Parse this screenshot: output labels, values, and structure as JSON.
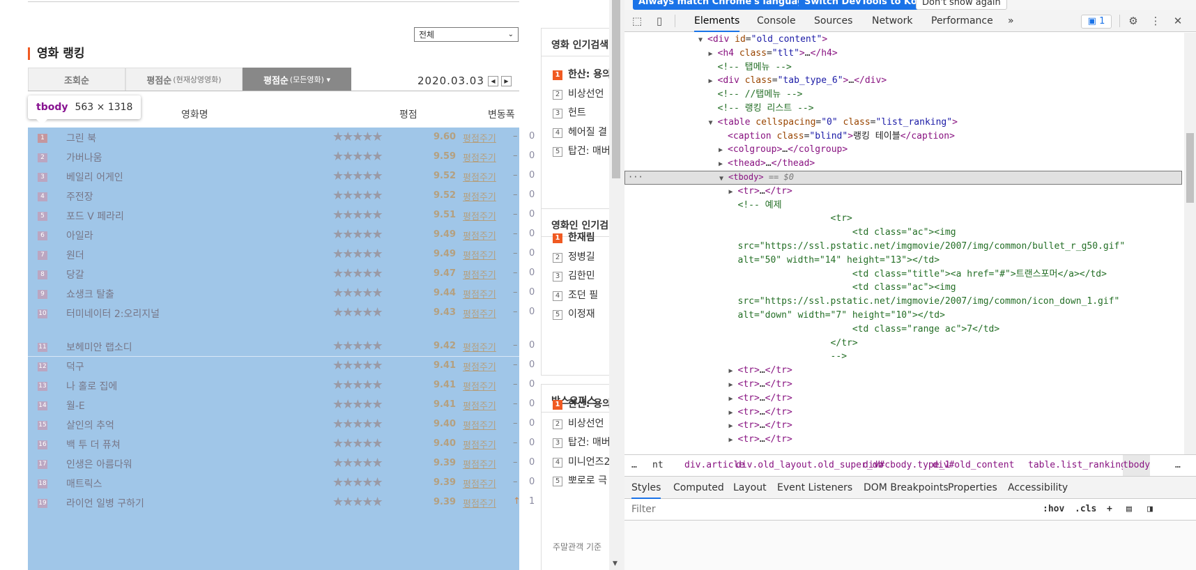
{
  "browser_infobar": {
    "btn1": "Always match Chrome's language",
    "btn2": "Switch DevTools to Korean",
    "btn3": "Don't show again"
  },
  "web": {
    "select_value": "전체",
    "section_title": "영화 랭킹",
    "tabs": [
      {
        "label": "조회순",
        "sub": ""
      },
      {
        "label": "평점순",
        "sub": "(현재상영영화)"
      },
      {
        "label": "평점순",
        "sub": "(모든영화) ▾"
      }
    ],
    "date": "2020.03.03",
    "nav_prev": "◀",
    "nav_next": "▶",
    "tooltip_tag": "tbody",
    "tooltip_size": "563 × 1318",
    "col_title": "영화명",
    "col_score": "평점",
    "col_change": "변동폭",
    "rate_label": "평점주기",
    "stars": "★★★★★",
    "movies": [
      {
        "rank": "1",
        "title": "그린 북",
        "score": "9.60",
        "change": "–",
        "range": "0"
      },
      {
        "rank": "2",
        "title": "가버나움",
        "score": "9.59",
        "change": "–",
        "range": "0"
      },
      {
        "rank": "3",
        "title": "베일리 어게인",
        "score": "9.52",
        "change": "–",
        "range": "0"
      },
      {
        "rank": "4",
        "title": "주전장",
        "score": "9.52",
        "change": "–",
        "range": "0"
      },
      {
        "rank": "5",
        "title": "포드 V 페라리",
        "score": "9.51",
        "change": "–",
        "range": "0"
      },
      {
        "rank": "6",
        "title": "아일라",
        "score": "9.49",
        "change": "–",
        "range": "0"
      },
      {
        "rank": "7",
        "title": "원더",
        "score": "9.49",
        "change": "–",
        "range": "0"
      },
      {
        "rank": "8",
        "title": "당갈",
        "score": "9.47",
        "change": "–",
        "range": "0"
      },
      {
        "rank": "9",
        "title": "쇼생크 탈출",
        "score": "9.44",
        "change": "–",
        "range": "0"
      },
      {
        "rank": "10",
        "title": "터미네이터 2:오리지널",
        "score": "9.43",
        "change": "–",
        "range": "0"
      },
      {
        "rank": "11",
        "title": "보헤미안 랩소디",
        "score": "9.42",
        "change": "–",
        "range": "0"
      },
      {
        "rank": "12",
        "title": "덕구",
        "score": "9.41",
        "change": "–",
        "range": "0"
      },
      {
        "rank": "13",
        "title": "나 홀로 집에",
        "score": "9.41",
        "change": "–",
        "range": "0"
      },
      {
        "rank": "14",
        "title": "월-E",
        "score": "9.41",
        "change": "–",
        "range": "0"
      },
      {
        "rank": "15",
        "title": "살인의 추억",
        "score": "9.40",
        "change": "–",
        "range": "0"
      },
      {
        "rank": "16",
        "title": "백 투 더 퓨쳐",
        "score": "9.40",
        "change": "–",
        "range": "0"
      },
      {
        "rank": "17",
        "title": "인생은 아름다워",
        "score": "9.39",
        "change": "–",
        "range": "0"
      },
      {
        "rank": "18",
        "title": "매트릭스",
        "score": "9.39",
        "change": "–",
        "range": "0"
      },
      {
        "rank": "19",
        "title": "라이언 일병 구하기",
        "score": "9.39",
        "change": "↑",
        "range": "1"
      }
    ],
    "panel_search": {
      "title": "영화 인기검색",
      "items": [
        "한산: 용의",
        "비상선언",
        "헌트",
        "헤어질 결",
        "탑건: 매버"
      ]
    },
    "panel_people": {
      "title": "영화인 인기검",
      "items": [
        "한재림",
        "정병길",
        "김한민",
        "조던 필",
        "이정재"
      ]
    },
    "panel_box": {
      "title": "박스오피스",
      "items": [
        "한산: 용의",
        "비상선언",
        "탑건: 매버",
        "미니언즈2",
        "뽀로로 극"
      ],
      "foot": "주말관객 기준"
    }
  },
  "devtools": {
    "tabs": [
      "Elements",
      "Console",
      "Sources",
      "Network",
      "Performance"
    ],
    "more": "»",
    "message_count": "1",
    "dom_lines": [
      {
        "indent": 8,
        "tri": "▼",
        "html": "<span class='tg'>&lt;div</span> <span class='at'>id</span>=<span class='av'>\"old_content\"</span><span class='tg'>&gt;</span>"
      },
      {
        "indent": 9,
        "tri": "▶",
        "html": "<span class='tg'>&lt;h4</span> <span class='at'>class</span>=<span class='av'>\"tlt\"</span><span class='tg'>&gt;</span><span class='tx'>…</span><span class='tg'>&lt;/h4&gt;</span>"
      },
      {
        "indent": 9,
        "tri": "",
        "html": "<span class='cm'>&lt;!-- 탭메뉴 --&gt;</span>"
      },
      {
        "indent": 9,
        "tri": "▶",
        "html": "<span class='tg'>&lt;div</span> <span class='at'>class</span>=<span class='av'>\"tab_type_6\"</span><span class='tg'>&gt;</span><span class='tx'>…</span><span class='tg'>&lt;/div&gt;</span>"
      },
      {
        "indent": 9,
        "tri": "",
        "html": "<span class='cm'>&lt;!-- //탭메뉴 --&gt;</span>"
      },
      {
        "indent": 9,
        "tri": "",
        "html": "<span class='cm'>&lt;!-- 랭킹 리스트 --&gt;</span>"
      },
      {
        "indent": 9,
        "tri": "▼",
        "html": "<span class='tg'>&lt;table</span> <span class='at'>cellspacing</span>=<span class='av'>\"0\"</span> <span class='at'>class</span>=<span class='av'>\"list_ranking\"</span><span class='tg'>&gt;</span>"
      },
      {
        "indent": 10,
        "tri": "",
        "html": "<span class='tg'>&lt;caption</span> <span class='at'>class</span>=<span class='av'>\"blind\"</span><span class='tg'>&gt;</span><span class='tx'>랭킹 테이블</span><span class='tg'>&lt;/caption&gt;</span>"
      },
      {
        "indent": 10,
        "tri": "▶",
        "html": "<span class='tg'>&lt;colgroup&gt;</span><span class='tx'>…</span><span class='tg'>&lt;/colgroup&gt;</span>"
      },
      {
        "indent": 10,
        "tri": "▶",
        "html": "<span class='tg'>&lt;thead&gt;</span><span class='tx'>…</span><span class='tg'>&lt;/thead&gt;</span>"
      },
      {
        "indent": 10,
        "tri": "▼",
        "html": "<span class='tg'>&lt;tbody&gt;</span> <span style='color:#777;font-style:italic'>== $0</span>",
        "selected": true
      },
      {
        "indent": 11,
        "tri": "▶",
        "html": "<span class='tg'>&lt;tr&gt;</span><span class='tx'>…</span><span class='tg'>&lt;/tr&gt;</span>"
      },
      {
        "indent": 11,
        "tri": "",
        "html": "<span class='cm'>&lt;!-- 예제</span>"
      },
      {
        "indent": 11,
        "tri": "",
        "html": "<span class='cm'>                 &lt;tr&gt;</span>"
      },
      {
        "indent": 11,
        "tri": "",
        "html": "<span class='cm'>                     &lt;td class=\"ac\"&gt;&lt;img</span>"
      },
      {
        "indent": 11,
        "tri": "",
        "html": "<span class='cm'>src=\"https://ssl.pstatic.net/imgmovie/2007/img/common/bullet_r_g50.gif\"</span>"
      },
      {
        "indent": 11,
        "tri": "",
        "html": "<span class='cm'>alt=\"50\" width=\"14\" height=\"13\"&gt;&lt;/td&gt;</span>"
      },
      {
        "indent": 11,
        "tri": "",
        "html": "<span class='cm'>                     &lt;td class=\"title\"&gt;&lt;a href=\"#\"&gt;트랜스포머&lt;/a&gt;&lt;/td&gt;</span>"
      },
      {
        "indent": 11,
        "tri": "",
        "html": "<span class='cm'>                     &lt;td class=\"ac\"&gt;&lt;img</span>"
      },
      {
        "indent": 11,
        "tri": "",
        "html": "<span class='cm'>src=\"https://ssl.pstatic.net/imgmovie/2007/img/common/icon_down_1.gif\"</span>"
      },
      {
        "indent": 11,
        "tri": "",
        "html": "<span class='cm'>alt=\"down\" width=\"7\" height=\"10\"&gt;&lt;/td&gt;</span>"
      },
      {
        "indent": 11,
        "tri": "",
        "html": "<span class='cm'>                     &lt;td class=\"range ac\"&gt;7&lt;/td&gt;</span>"
      },
      {
        "indent": 11,
        "tri": "",
        "html": "<span class='cm'>                 &lt;/tr&gt;</span>"
      },
      {
        "indent": 11,
        "tri": "",
        "html": "<span class='cm'>                 --&gt;</span>"
      },
      {
        "indent": 11,
        "tri": "▶",
        "html": "<span class='tg'>&lt;tr&gt;</span><span class='tx'>…</span><span class='tg'>&lt;/tr&gt;</span>"
      },
      {
        "indent": 11,
        "tri": "▶",
        "html": "<span class='tg'>&lt;tr&gt;</span><span class='tx'>…</span><span class='tg'>&lt;/tr&gt;</span>"
      },
      {
        "indent": 11,
        "tri": "▶",
        "html": "<span class='tg'>&lt;tr&gt;</span><span class='tx'>…</span><span class='tg'>&lt;/tr&gt;</span>"
      },
      {
        "indent": 11,
        "tri": "▶",
        "html": "<span class='tg'>&lt;tr&gt;</span><span class='tx'>…</span><span class='tg'>&lt;/tr&gt;</span>"
      },
      {
        "indent": 11,
        "tri": "▶",
        "html": "<span class='tg'>&lt;tr&gt;</span><span class='tx'>…</span><span class='tg'>&lt;/tr&gt;</span>"
      },
      {
        "indent": 11,
        "tri": "▶",
        "html": "<span class='tg'>&lt;tr&gt;</span><span class='tx'>…</span><span class='tg'>&lt;/tr&gt;</span>"
      }
    ],
    "breadcrumbs": [
      "…",
      "nt",
      "div.article",
      "div.old_layout.old_super_db",
      "div#cbody.type_1",
      "div#old_content",
      "table.list_ranking",
      "tbody",
      "…"
    ],
    "style_tabs": [
      "Styles",
      "Computed",
      "Layout",
      "Event Listeners",
      "DOM Breakpoints",
      "Properties",
      "Accessibility"
    ],
    "filter_placeholder": "Filter",
    "filter_hov": ":hov",
    "filter_cls": ".cls",
    "filter_plus": "+"
  }
}
